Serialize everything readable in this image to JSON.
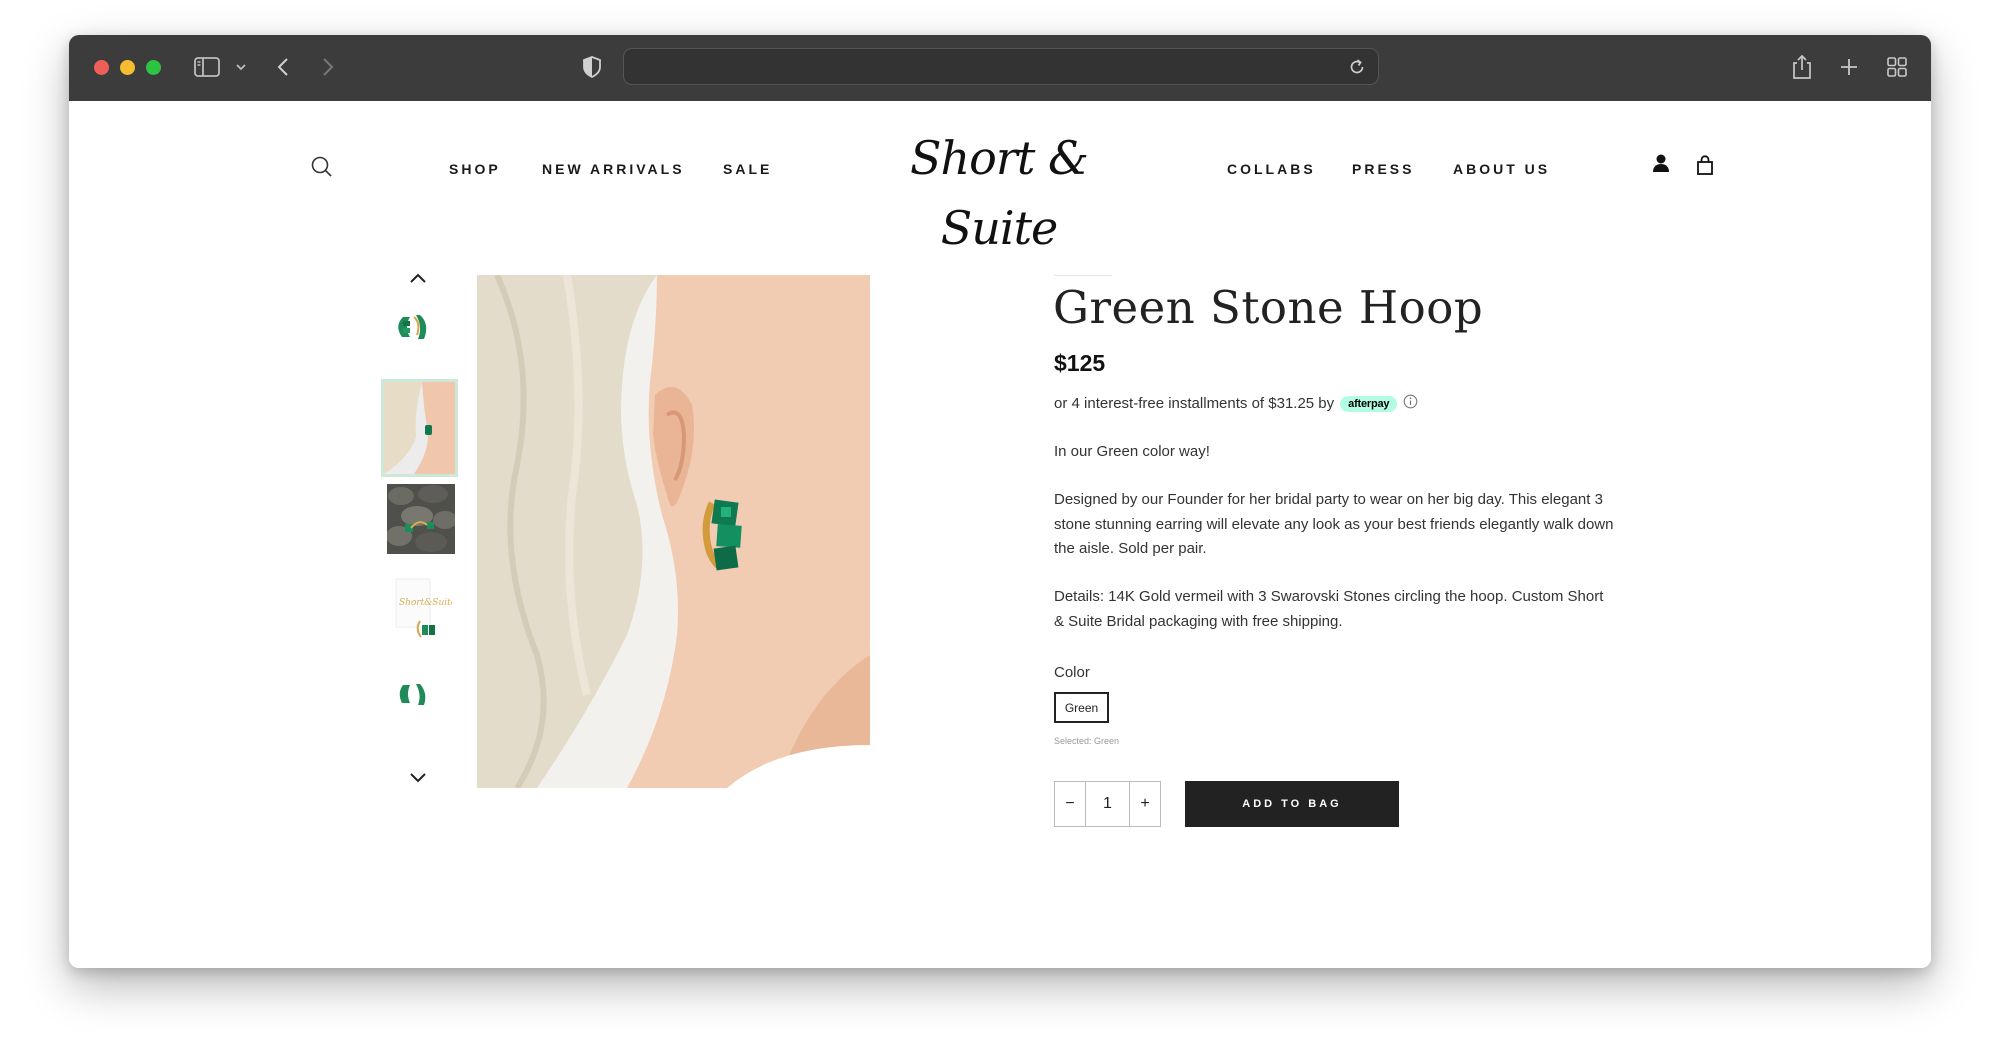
{
  "nav": {
    "left": [
      "SHOP",
      "NEW ARRIVALS",
      "SALE"
    ],
    "right": [
      "COLLABS",
      "PRESS",
      "ABOUT US"
    ],
    "logo": "Short & Suite"
  },
  "product": {
    "title": "Green Stone Hoop",
    "price": "$125",
    "afterpay_text": "or 4 interest-free installments of $31.25 by",
    "afterpay_badge": "afterpay",
    "desc1": "In our Green color way!",
    "desc2": "Designed by our Founder for her bridal party to wear on her big day. This elegant 3 stone stunning earring will elevate any look as your best friends elegantly walk down the aisle. Sold per pair.",
    "desc3": "Details: 14K Gold vermeil with 3 Swarovski Stones circling the hoop. Custom Short & Suite Bridal packaging with free shipping.",
    "color_label": "Color",
    "color_option": "Green",
    "selected_note": "Selected: Green",
    "qty_minus": "−",
    "qty_value": "1",
    "qty_plus": "+",
    "add_to_bag": "ADD TO BAG"
  },
  "colors": {
    "accent_afterpay": "#b2fce4",
    "button_bg": "#222222",
    "thumb_active_border": "#cde8d6"
  }
}
